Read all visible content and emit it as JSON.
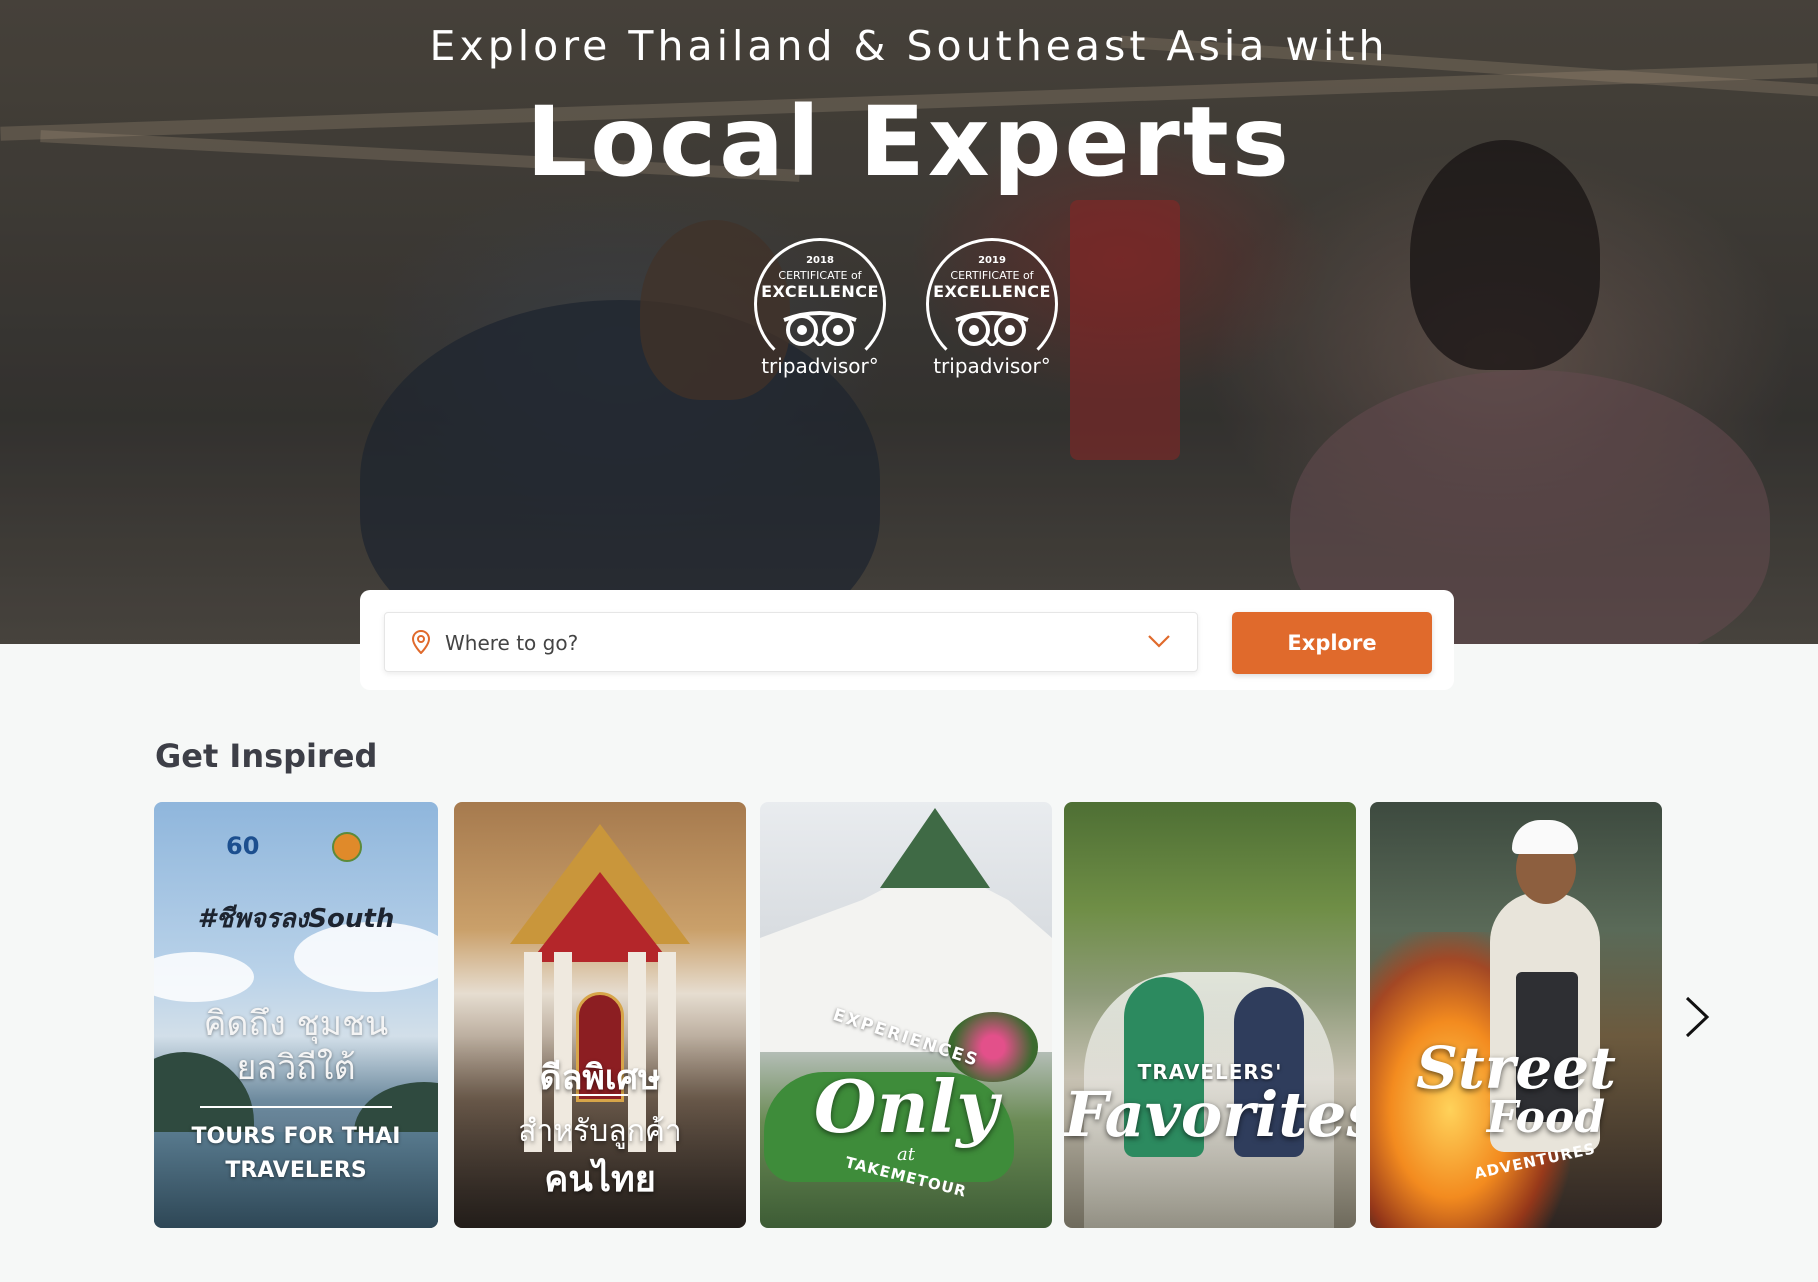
{
  "hero": {
    "subtitle": "Explore Thailand & Southeast Asia with",
    "title": "Local Experts",
    "badges": [
      {
        "year": "2018",
        "cert": "CERTIFICATE of",
        "excellence": "EXCELLENCE",
        "brand": "tripadvisor°"
      },
      {
        "year": "2019",
        "cert": "CERTIFICATE of",
        "excellence": "EXCELLENCE",
        "brand": "tripadvisor°"
      }
    ]
  },
  "search": {
    "placeholder": "Where to go?",
    "button_label": "Explore",
    "pin_icon": "location-pin-icon",
    "dropdown_icon": "chevron-down-icon"
  },
  "inspired": {
    "title": "Get Inspired",
    "cards": [
      {
        "logo_60": "60",
        "hashtag": "#ชีพจรลงSouth",
        "thai_line1": "คิดถึง ชุมชน",
        "thai_line2": "ยลวิถีใต้",
        "eng_line1": "TOURS FOR THAI",
        "eng_line2": "TRAVELERS"
      },
      {
        "line1": "ดีลพิเศษ",
        "line2": "สำหรับลูกค้า",
        "line3": "คนไทย"
      },
      {
        "top": "EXPERIENCES",
        "main": "Only",
        "at": "at",
        "bottom": "TAKEMETOUR"
      },
      {
        "top": "TRAVELERS'",
        "main": "Favorites"
      },
      {
        "main1": "Street",
        "main2": "Food",
        "bottom": "ADVENTURES"
      }
    ],
    "next_icon": "chevron-right-icon"
  },
  "colors": {
    "accent": "#e06a2c",
    "heading": "#3d3f47",
    "page_bg": "#f6f8f7"
  }
}
